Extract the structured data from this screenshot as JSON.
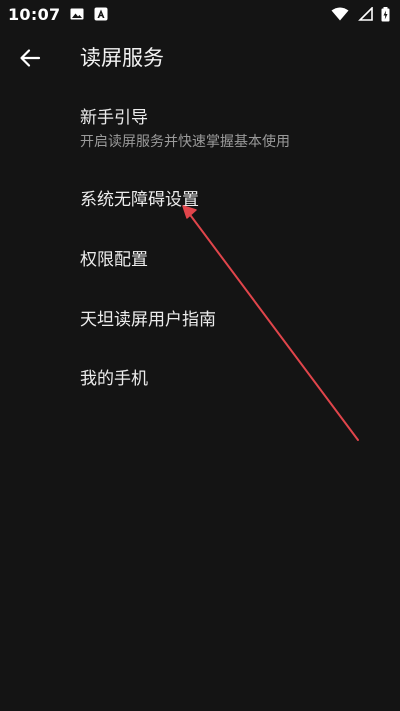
{
  "status_bar": {
    "time": "10:07",
    "icons": [
      "image-icon",
      "app-notification-icon",
      "wifi-icon",
      "signal-icon",
      "battery-charging-icon"
    ]
  },
  "header": {
    "title": "读屏服务",
    "back_icon": "arrow-left-icon"
  },
  "menu": {
    "items": [
      {
        "label": "新手引导",
        "subtitle": "开启读屏服务并快速掌握基本使用"
      },
      {
        "label": "系统无障碍设置"
      },
      {
        "label": "权限配置"
      },
      {
        "label": "天坦读屏用户指南"
      },
      {
        "label": "我的手机"
      }
    ]
  },
  "colors": {
    "background": "#141414",
    "text_primary": "#ececec",
    "text_secondary": "#9a9a9a",
    "annotation_arrow": "#e0454b"
  }
}
